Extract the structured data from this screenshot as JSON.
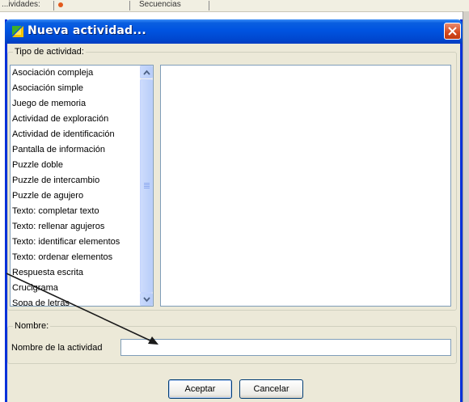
{
  "background_app": {
    "left_fragment": "...ividades:",
    "right_fragment": "Secuencias"
  },
  "dialog": {
    "title": "Nueva actividad...",
    "activity_type_group": {
      "legend": "Tipo de actividad:",
      "items": [
        "Asociación compleja",
        "Asociación simple",
        "Juego de memoria",
        "Actividad de exploración",
        "Actividad de identificación",
        "Pantalla de información",
        "Puzzle doble",
        "Puzzle de intercambio",
        "Puzzle de agujero",
        "Texto: completar texto",
        "Texto: rellenar agujeros",
        "Texto: identificar elementos",
        "Texto: ordenar elementos",
        "Respuesta escrita",
        "Crucigrama",
        "Sopa de letras"
      ]
    },
    "name_group": {
      "legend": "Nombre:",
      "label": "Nombre de la actividad",
      "value": ""
    },
    "buttons": {
      "accept": "Aceptar",
      "cancel": "Cancelar"
    }
  },
  "colors": {
    "title_bar": "#0053e0",
    "dialog_bg": "#ece9d8",
    "close_button": "#d4481c",
    "field_border": "#7f9db9"
  }
}
